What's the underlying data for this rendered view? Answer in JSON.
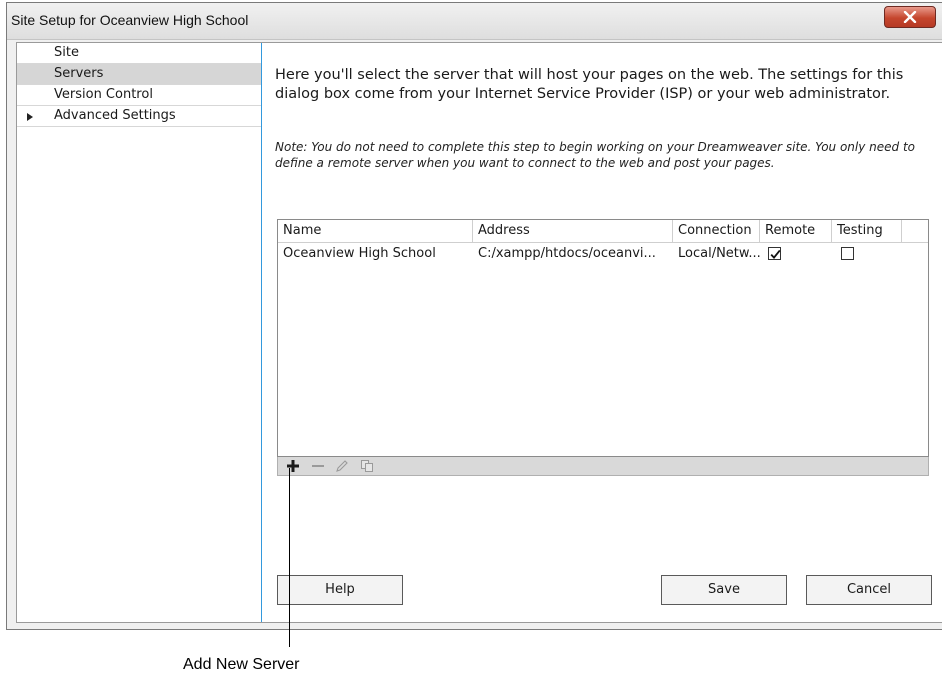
{
  "window": {
    "title": "Site Setup for Oceanview High School",
    "close_label": "X"
  },
  "sidebar": {
    "items": [
      {
        "label": "Site"
      },
      {
        "label": "Servers",
        "selected": true
      },
      {
        "label": "Version Control"
      },
      {
        "label": "Advanced Settings",
        "expandable": true
      }
    ]
  },
  "main": {
    "intro": "Here you'll select the server that will host your pages on the web. The settings for this dialog box come from your Internet Service Provider (ISP) or your web administrator.",
    "note": "Note: You do not need to complete this step to begin working on your Dreamweaver site. You only need to define a remote server when you want to connect to the web and post your pages."
  },
  "table": {
    "columns": [
      "Name",
      "Address",
      "Connection",
      "Remote",
      "Testing"
    ],
    "rows": [
      {
        "name": "Oceanview High School",
        "address": "C:/xampp/htdocs/oceanvi...",
        "connection": "Local/Netw...",
        "remote": true,
        "testing": false
      }
    ]
  },
  "toolbar": {
    "icons": [
      "plus-icon",
      "minus-icon",
      "pencil-icon",
      "duplicate-icon"
    ]
  },
  "buttons": {
    "help": "Help",
    "save": "Save",
    "cancel": "Cancel"
  },
  "callout": {
    "text": "Add New Server"
  },
  "colors": {
    "accent_border": "#3399dd",
    "close_button": "#c5462e",
    "selected_row": "#d6d6d6"
  }
}
